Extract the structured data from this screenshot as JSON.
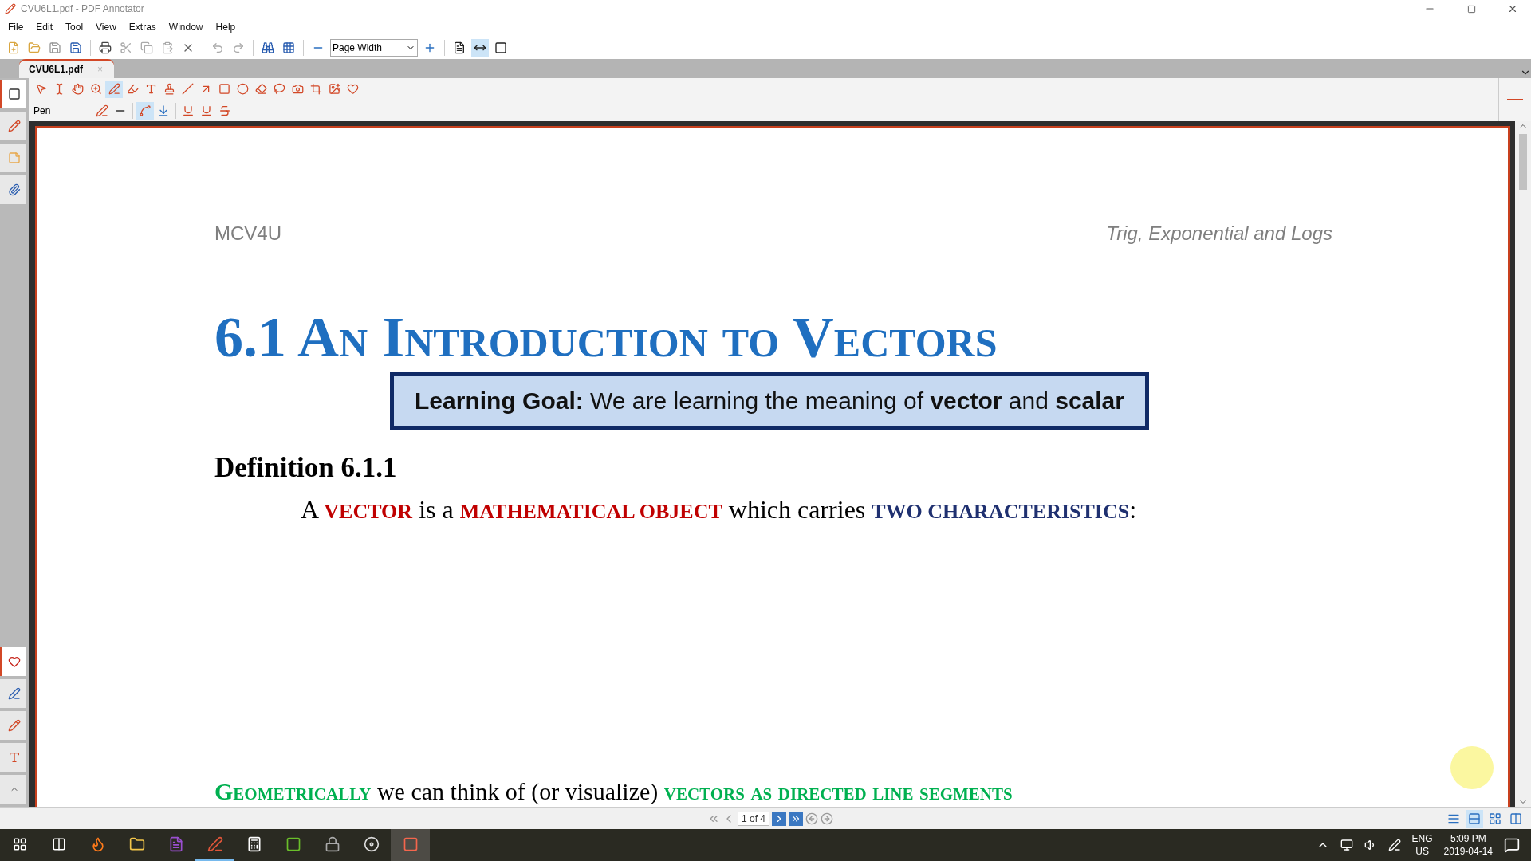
{
  "window": {
    "title": "CVU6L1.pdf - PDF Annotator"
  },
  "menu": [
    "File",
    "Edit",
    "Tool",
    "View",
    "Extras",
    "Window",
    "Help"
  ],
  "zoom": {
    "value": "Page Width"
  },
  "view_buttons": [
    {
      "selected": false
    },
    {
      "selected": true
    },
    {
      "selected": false
    }
  ],
  "tab": {
    "label": "CVU6L1.pdf",
    "close": "×",
    "selected": true
  },
  "tools": [
    {
      "selected": false
    },
    {
      "selected": false
    },
    {
      "selected": false
    },
    {
      "selected": false
    },
    {
      "selected": true
    },
    {
      "selected": false
    },
    {
      "selected": false
    },
    {
      "selected": false
    },
    {
      "selected": false
    },
    {
      "selected": false
    },
    {
      "selected": false
    },
    {
      "selected": false
    },
    {
      "selected": false
    },
    {
      "selected": false
    },
    {
      "selected": false
    },
    {
      "selected": false
    },
    {
      "selected": false
    },
    {
      "selected": false
    }
  ],
  "tool_options": {
    "label": "Pen",
    "smoothing_on": true
  },
  "sidebar_top": [
    {
      "selected": true
    },
    {
      "selected": false
    },
    {
      "selected": false
    },
    {
      "selected": false
    }
  ],
  "sidebar_bottom": [
    {
      "selected": true
    },
    {
      "selected": false
    },
    {
      "selected": false
    },
    {
      "selected": false
    }
  ],
  "document": {
    "header_left": "MCV4U",
    "header_right": "Trig, Exponential and Logs",
    "title": "6.1 An Introduction to Vectors",
    "goal": "**Learning Goal:** We are learning the meaning of **vector** and **scalar**",
    "definition": "Definition 6.1.1",
    "sentence": [
      {
        "text": "A ",
        "kind": "plain"
      },
      {
        "text": "VECTOR",
        "kind": "term"
      },
      {
        "text": " is a ",
        "kind": "plain"
      },
      {
        "text": "MATHEMATICAL OBJECT",
        "kind": "term"
      },
      {
        "text": " which carries ",
        "kind": "plain"
      },
      {
        "text": "TWO CHARACTERISTICS",
        "kind": "key"
      },
      {
        "text": ":",
        "kind": "plain"
      }
    ],
    "bottom_line": [
      {
        "text": "Geometrically",
        "kind": "green"
      },
      {
        "text": " we can think of (or visualize) ",
        "kind": "plain"
      },
      {
        "text": "vectors as directed line segments",
        "kind": "green"
      }
    ]
  },
  "page_nav": {
    "page": "1 of 4"
  },
  "layout_buttons": [
    {
      "selected": false
    },
    {
      "selected": true
    },
    {
      "selected": false
    },
    {
      "selected": false
    }
  ],
  "taskbar": {
    "apps": [
      {
        "selected": false,
        "running": false
      },
      {
        "selected": false,
        "running": false
      },
      {
        "selected": false,
        "running": false
      },
      {
        "selected": false,
        "running": true
      },
      {
        "selected": false,
        "running": false
      },
      {
        "selected": false,
        "running": false
      },
      {
        "selected": false,
        "running": false
      },
      {
        "selected": false,
        "running": false
      },
      {
        "selected": true,
        "running": false
      }
    ],
    "language": "ENG",
    "region": "US",
    "time": "5:09 PM",
    "date": "2019-04-14"
  }
}
